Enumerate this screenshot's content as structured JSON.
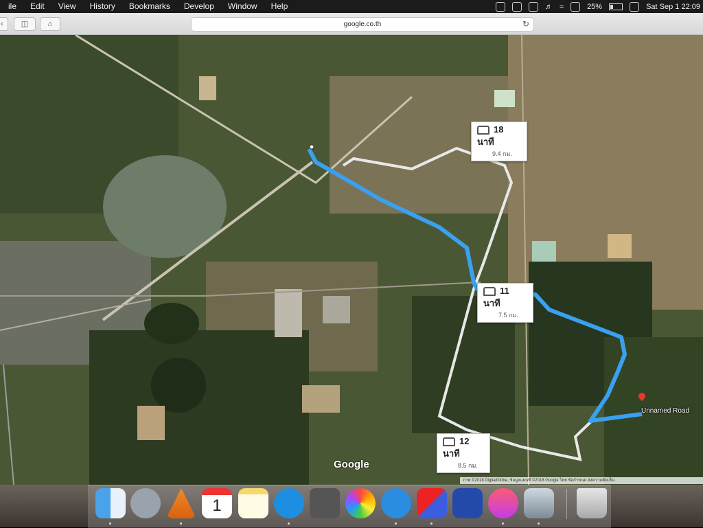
{
  "menubar": {
    "items": [
      "ile",
      "Edit",
      "View",
      "History",
      "Bookmarks",
      "Develop",
      "Window",
      "Help"
    ],
    "battery": "25%",
    "clock": "Sat Sep 1  22:09"
  },
  "toolbar": {
    "url": "google.co.th",
    "reload_icon": "reload-icon"
  },
  "map": {
    "routes": [
      {
        "time": "18 นาที",
        "distance": "9.4 กม."
      },
      {
        "time": "11 นาที",
        "distance": "7.5 กม."
      },
      {
        "time": "12 นาที",
        "distance": "8.5 กม."
      }
    ],
    "destination": "Unnamed Road",
    "brand": "Google",
    "copyright": "ภาพ ©2018 DigitalGlobe, ข้อมูลแผนที่ ©2018 Google   ไทย   ข้อกำหนด   ส่งความคิดเห็น",
    "route_color": "#3aa0f0",
    "alt_route_color": "#e8e8e8"
  },
  "dock": {
    "apps": [
      "finder-icon",
      "launchpad-icon",
      "vlc-icon",
      "calendar-icon",
      "notes-icon",
      "app-store-icon",
      "system-preferences-icon",
      "photos-icon",
      "safari-icon",
      "parallels-icon",
      "keynote-icon",
      "itunes-icon",
      "preview-icon",
      "trash-icon"
    ],
    "calendar_day": "1"
  }
}
